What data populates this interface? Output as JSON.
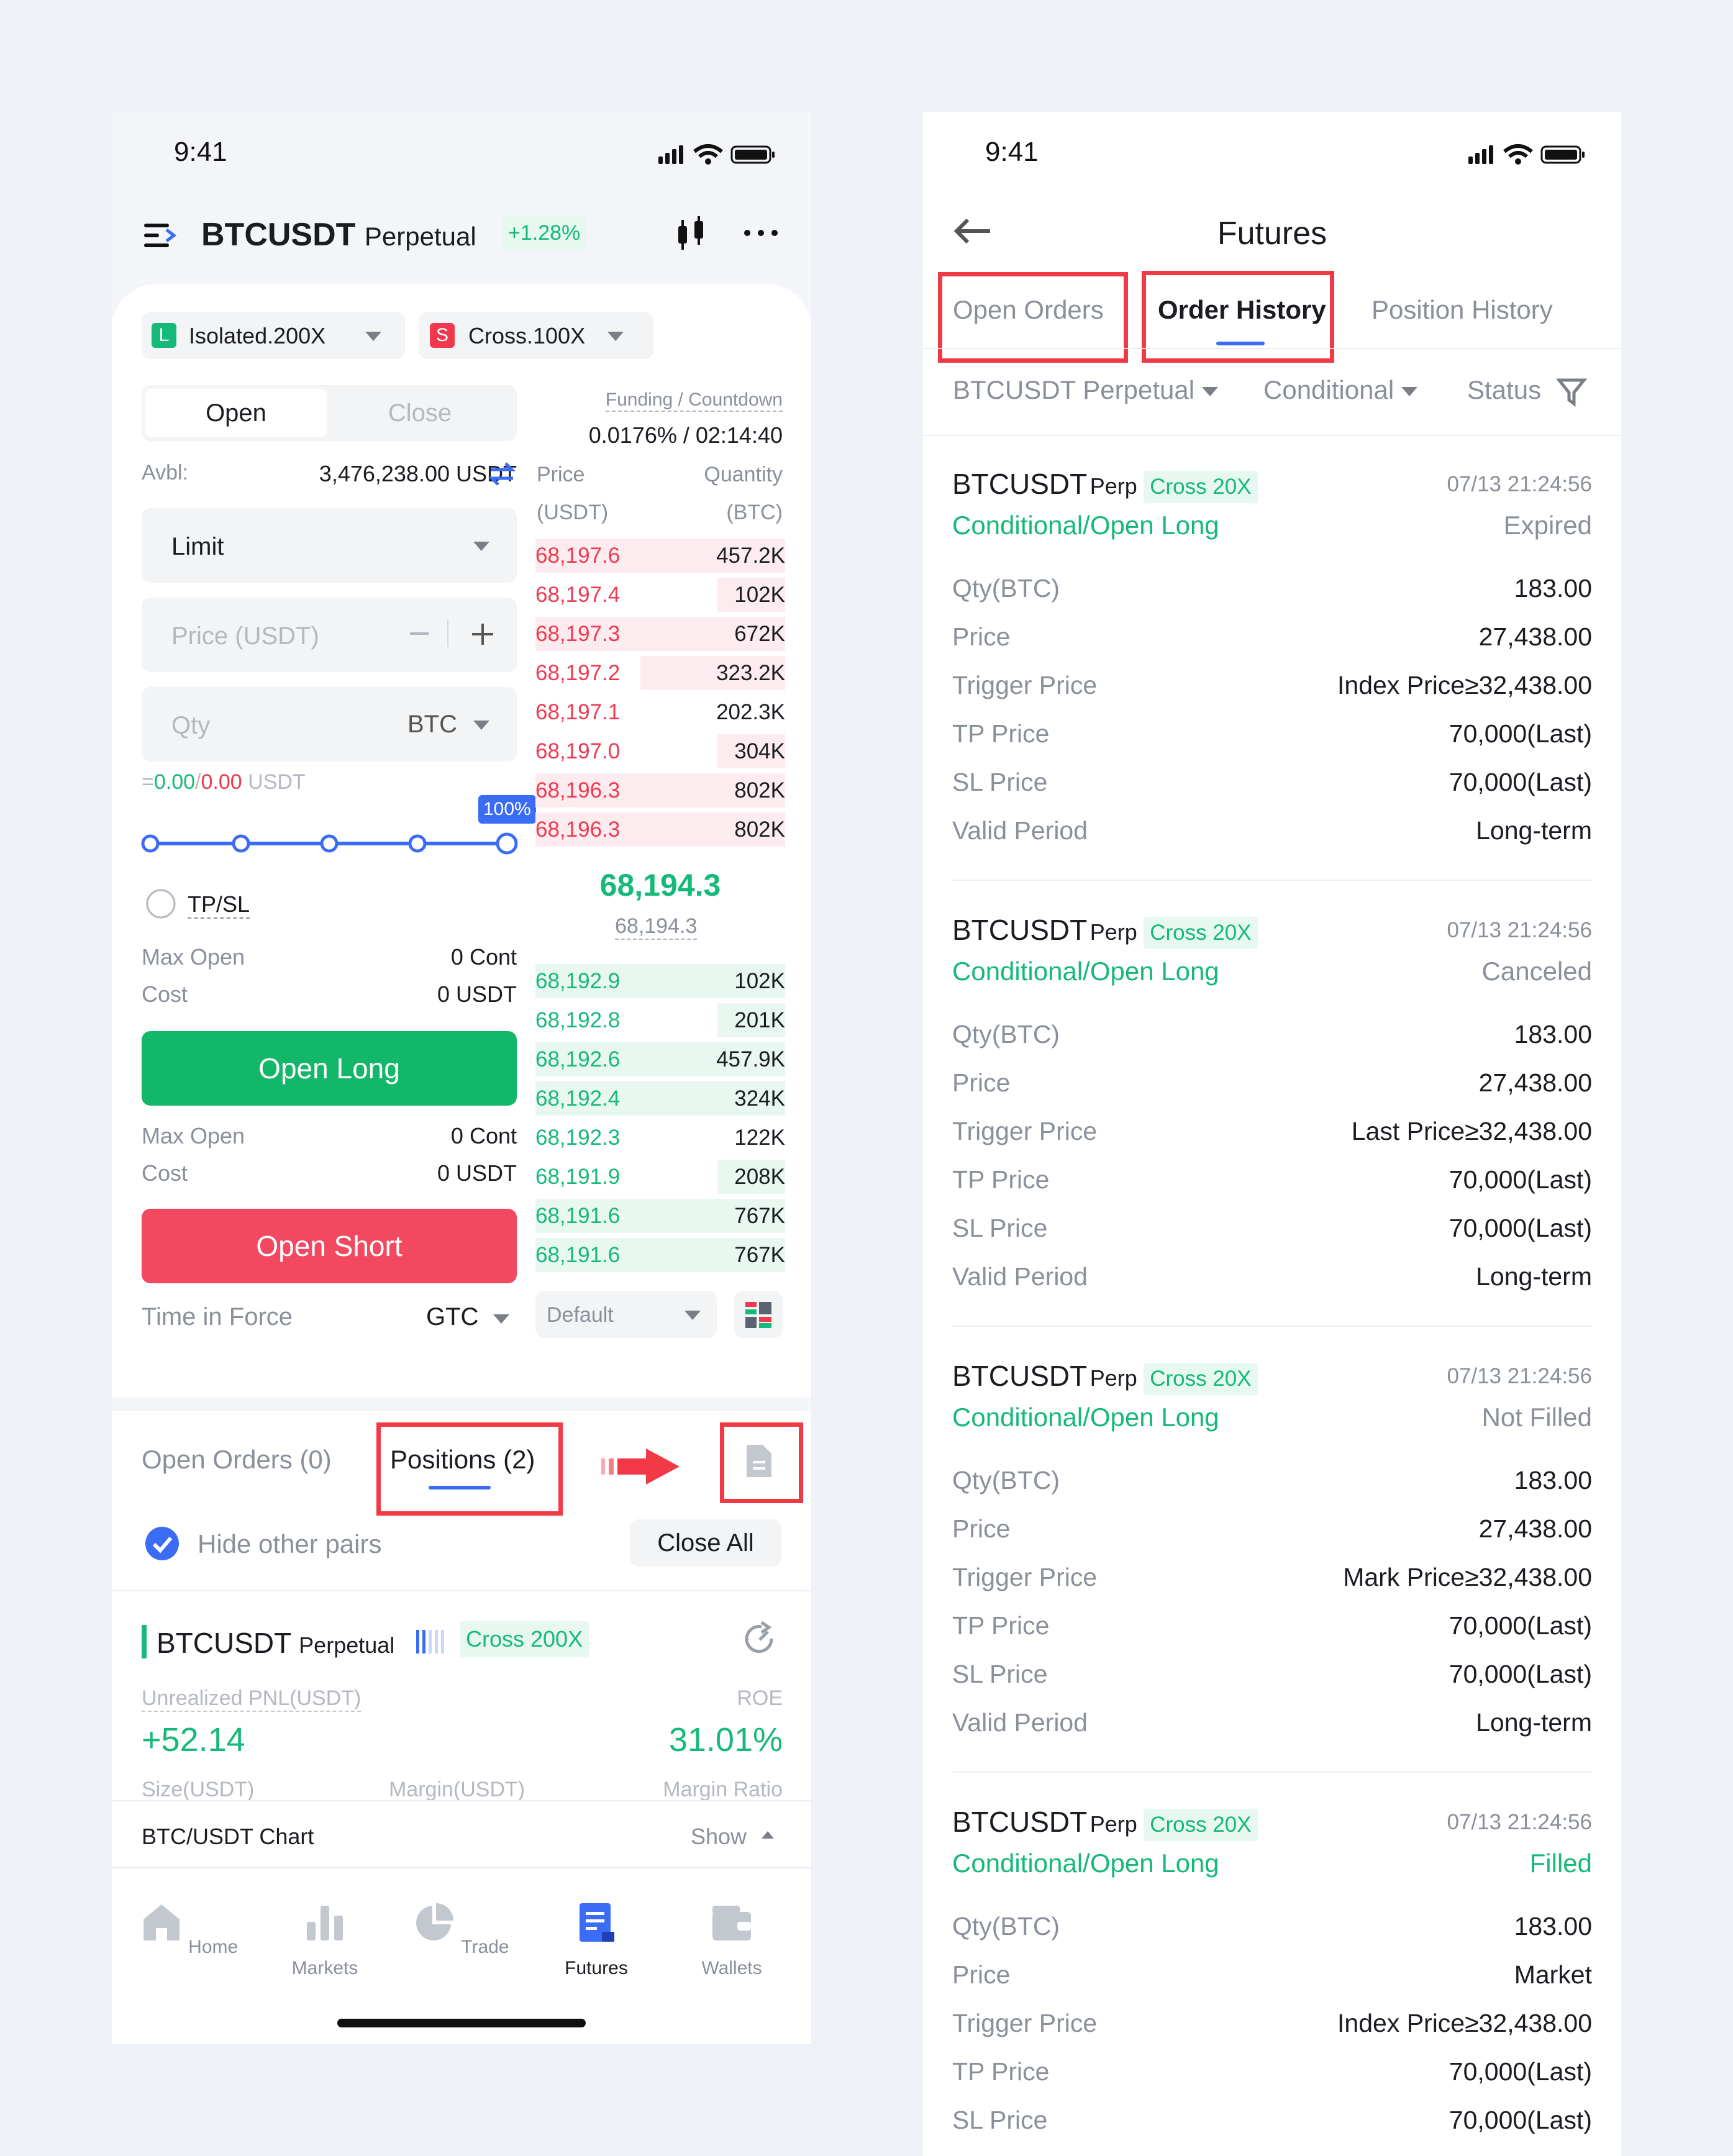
{
  "left": {
    "status_time": "9:41",
    "header": {
      "symbol": "BTCUSDT",
      "contract": "Perpetual",
      "change": "+1.28%"
    },
    "margin_long": {
      "tag": "L",
      "label": "Isolated.200X"
    },
    "margin_short": {
      "tag": "S",
      "label": "Cross.100X"
    },
    "side_tabs": {
      "open": "Open",
      "close": "Close"
    },
    "funding": {
      "label": "Funding / Countdown",
      "value": "0.0176% / 02:14:40"
    },
    "avbl": {
      "label": "Avbl:",
      "value": "3,476,238.00 USDT"
    },
    "order_type": "Limit",
    "price_placeholder": "Price (USDT)",
    "qty_placeholder": "Qty",
    "qty_unit": "BTC",
    "equiv": {
      "prefix": "=",
      "long": "0.00",
      "sep": "/",
      "short": "0.00",
      "unit": "USDT"
    },
    "slider_badge": "100%",
    "tpsl": "TP/SL",
    "long_info": {
      "max_open_label": "Max Open",
      "max_open": "0 Cont",
      "cost_label": "Cost",
      "cost": "0 USDT"
    },
    "open_long": "Open Long",
    "short_info": {
      "max_open_label": "Max Open",
      "max_open": "0 Cont",
      "cost_label": "Cost",
      "cost": "0 USDT"
    },
    "open_short": "Open Short",
    "tif": {
      "label": "Time in Force",
      "value": "GTC"
    },
    "depth_select": "Default",
    "orderbook": {
      "price_header": "Price",
      "price_unit": "(USDT)",
      "qty_header": "Quantity",
      "qty_unit": "(BTC)",
      "asks": [
        {
          "price": "68,197.6",
          "qty": "457.2K",
          "depth": 1.0
        },
        {
          "price": "68,197.4",
          "qty": "102K",
          "depth": 0.27
        },
        {
          "price": "68,197.3",
          "qty": "672K",
          "depth": 1.0
        },
        {
          "price": "68,197.2",
          "qty": "323.2K",
          "depth": 0.58
        },
        {
          "price": "68,197.1",
          "qty": "202.3K",
          "depth": 0.0
        },
        {
          "price": "68,197.0",
          "qty": "304K",
          "depth": 0.27
        },
        {
          "price": "68,196.3",
          "qty": "802K",
          "depth": 1.0
        },
        {
          "price": "68,196.3",
          "qty": "802K",
          "depth": 1.0
        }
      ],
      "last_price": "68,194.3",
      "mark_price": "68,194.3",
      "bids": [
        {
          "price": "68,192.9",
          "qty": "102K",
          "depth": 1.0
        },
        {
          "price": "68,192.8",
          "qty": "201K",
          "depth": 0.27
        },
        {
          "price": "68,192.6",
          "qty": "457.9K",
          "depth": 1.0
        },
        {
          "price": "68,192.4",
          "qty": "324K",
          "depth": 1.0
        },
        {
          "price": "68,192.3",
          "qty": "122K",
          "depth": 0.0
        },
        {
          "price": "68,191.9",
          "qty": "208K",
          "depth": 0.27
        },
        {
          "price": "68,191.6",
          "qty": "767K",
          "depth": 1.0
        },
        {
          "price": "68,191.6",
          "qty": "767K",
          "depth": 1.0
        }
      ]
    },
    "bottom_tabs": {
      "open_orders": "Open Orders (0)",
      "positions": "Positions (2)"
    },
    "hide_pairs": "Hide other pairs",
    "close_all": "Close All",
    "position": {
      "symbol": "BTCUSDT",
      "contract": "Perpetual",
      "badge": "Cross 200X",
      "pnl_label": "Unrealized PNL(USDT)",
      "roe_label": "ROE",
      "pnl": "+52.14",
      "roe": "31.01%",
      "size_label": "Size(USDT)",
      "margin_label": "Margin(USDT)",
      "ratio_label": "Margin Ratio"
    },
    "chart_bar": {
      "label": "BTC/USDT Chart",
      "action": "Show"
    },
    "nav": [
      {
        "label": "Home",
        "icon": "home-icon"
      },
      {
        "label": "Markets",
        "icon": "markets-icon"
      },
      {
        "label": "Trade",
        "icon": "trade-icon"
      },
      {
        "label": "Futures",
        "icon": "futures-icon"
      },
      {
        "label": "Wallets",
        "icon": "wallet-icon"
      }
    ]
  },
  "right": {
    "status_time": "9:41",
    "title": "Futures",
    "tabs": {
      "open_orders": "Open Orders",
      "order_history": "Order History",
      "position_history": "Position History"
    },
    "filters": {
      "symbol": "BTCUSDT Perpetual",
      "type": "Conditional",
      "status": "Status"
    },
    "orders": [
      {
        "symbol": "BTCUSDT",
        "contract": "Perp",
        "badge": "Cross 20X",
        "time": "07/13 21:24:56",
        "kind": "Conditional/Open Long",
        "status": "Expired",
        "rows": [
          {
            "k": "Qty(BTC)",
            "v": "183.00"
          },
          {
            "k": "Price",
            "v": "27,438.00"
          },
          {
            "k": "Trigger Price",
            "v": "Index Price≥32,438.00"
          },
          {
            "k": "TP Price",
            "v": "70,000(Last)"
          },
          {
            "k": "SL Price",
            "v": "70,000(Last)"
          },
          {
            "k": "Valid Period",
            "v": "Long-term"
          }
        ]
      },
      {
        "symbol": "BTCUSDT",
        "contract": "Perp",
        "badge": "Cross 20X",
        "time": "07/13 21:24:56",
        "kind": "Conditional/Open Long",
        "status": "Canceled",
        "rows": [
          {
            "k": "Qty(BTC)",
            "v": "183.00"
          },
          {
            "k": "Price",
            "v": "27,438.00"
          },
          {
            "k": "Trigger Price",
            "v": "Last Price≥32,438.00"
          },
          {
            "k": "TP Price",
            "v": "70,000(Last)"
          },
          {
            "k": "SL Price",
            "v": "70,000(Last)"
          },
          {
            "k": "Valid Period",
            "v": "Long-term"
          }
        ]
      },
      {
        "symbol": "BTCUSDT",
        "contract": "Perp",
        "badge": "Cross 20X",
        "time": "07/13 21:24:56",
        "kind": "Conditional/Open Long",
        "status": "Not Filled",
        "rows": [
          {
            "k": "Qty(BTC)",
            "v": "183.00"
          },
          {
            "k": "Price",
            "v": "27,438.00"
          },
          {
            "k": "Trigger Price",
            "v": "Mark Price≥32,438.00"
          },
          {
            "k": "TP Price",
            "v": "70,000(Last)"
          },
          {
            "k": "SL Price",
            "v": "70,000(Last)"
          },
          {
            "k": "Valid Period",
            "v": "Long-term"
          }
        ]
      },
      {
        "symbol": "BTCUSDT",
        "contract": "Perp",
        "badge": "Cross 20X",
        "time": "07/13 21:24:56",
        "kind": "Conditional/Open Long",
        "status": "Filled",
        "rows": [
          {
            "k": "Qty(BTC)",
            "v": "183.00"
          },
          {
            "k": "Price",
            "v": "Market"
          },
          {
            "k": "Trigger Price",
            "v": "Index Price≥32,438.00"
          },
          {
            "k": "TP Price",
            "v": "70,000(Last)"
          },
          {
            "k": "SL Price",
            "v": "70,000(Last)"
          }
        ]
      }
    ]
  },
  "colors": {
    "green": "#16b979",
    "red": "#f0394f",
    "blue": "#3b6cf6",
    "highlight": "#f23a46"
  }
}
